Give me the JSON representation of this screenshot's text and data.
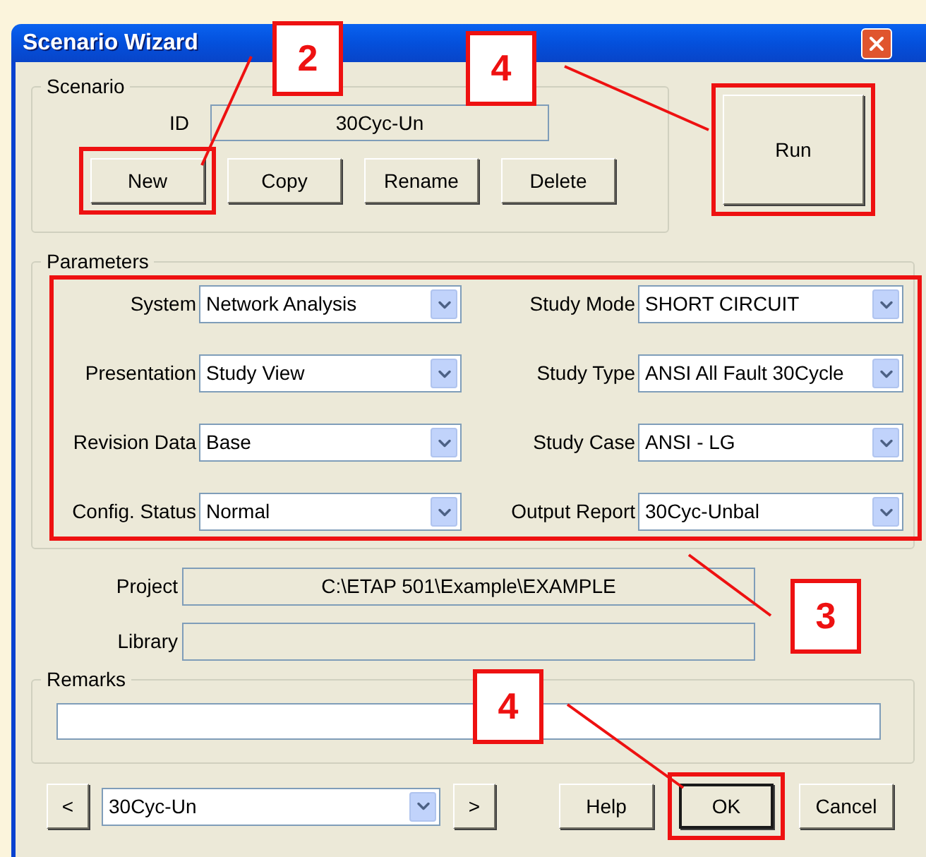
{
  "window": {
    "title": "Scenario Wizard"
  },
  "scenario": {
    "label": "Scenario",
    "id_label": "ID",
    "id_value": "30Cyc-Un",
    "buttons": [
      {
        "label": "New",
        "highlighted": true
      },
      {
        "label": "Copy",
        "highlighted": false
      },
      {
        "label": "Rename",
        "highlighted": false
      },
      {
        "label": "Delete",
        "highlighted": false
      }
    ]
  },
  "run_button": {
    "label": "Run",
    "highlighted": true
  },
  "parameters": {
    "label": "Parameters",
    "highlighted": true,
    "left": [
      {
        "label": "System",
        "value": "Network Analysis"
      },
      {
        "label": "Presentation",
        "value": "Study View"
      },
      {
        "label": "Revision Data",
        "value": "Base"
      },
      {
        "label": "Config. Status",
        "value": "Normal"
      }
    ],
    "right": [
      {
        "label": "Study Mode",
        "value": "SHORT CIRCUIT"
      },
      {
        "label": "Study Type",
        "value": "ANSI All Fault 30Cycle"
      },
      {
        "label": "Study Case",
        "value": "ANSI - LG"
      },
      {
        "label": "Output Report",
        "value": "30Cyc-Unbal"
      }
    ]
  },
  "project": {
    "label": "Project",
    "value": "C:\\ETAP 501\\Example\\EXAMPLE"
  },
  "library": {
    "label": "Library"
  },
  "remarks": {
    "label": "Remarks"
  },
  "footer": {
    "prev": "<",
    "scenario": "30Cyc-Un",
    "next": ">",
    "buttons": [
      {
        "label": "Help",
        "highlighted": false,
        "default": false
      },
      {
        "label": "OK",
        "highlighted": true,
        "default": true
      },
      {
        "label": "Cancel",
        "highlighted": false,
        "default": false
      }
    ]
  },
  "callouts": [
    {
      "label": "2"
    },
    {
      "label": "4"
    },
    {
      "label": "3"
    },
    {
      "label": "4"
    }
  ]
}
